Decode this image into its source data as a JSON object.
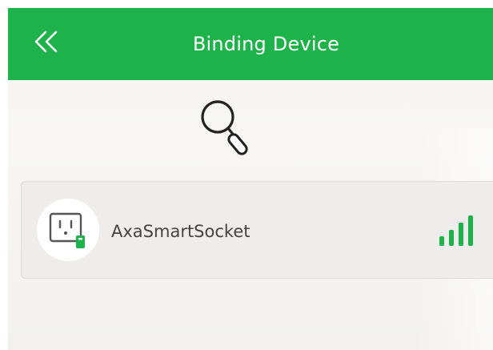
{
  "header": {
    "title": "Binding Device",
    "back_icon": "double-chevron-left-icon",
    "background_color": "#1eb24a"
  },
  "search": {
    "icon": "search-icon"
  },
  "device_list": [
    {
      "name": "AxaSmartSocket",
      "icon": "smart-socket-icon",
      "signal_icon": "signal-strength-icon",
      "signal_bars": 4,
      "accent_color": "#1eb24a"
    }
  ]
}
